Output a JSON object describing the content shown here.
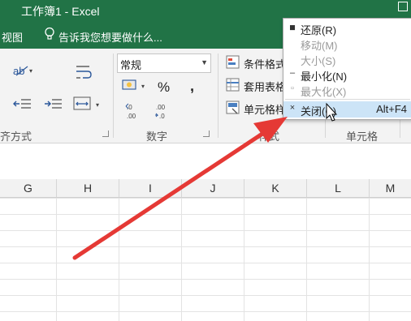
{
  "window": {
    "title": "工作簿1 - Excel"
  },
  "ribbon": {
    "view_tab": "视图",
    "tell_me": "告诉我您想要做什么...",
    "number_format": "常规",
    "percent": "%",
    "comma": ",",
    "dec_increase": "←0\n.00",
    "dec_decrease": ".00\n→.0",
    "cond_format": "条件格式",
    "table_format": "套用表格",
    "cell_styles": "单元格样",
    "groups": {
      "alignment": "齐方式",
      "number": "数字",
      "styles": "样式",
      "cells": "单元格"
    }
  },
  "columns": [
    "G",
    "H",
    "I",
    "J",
    "K",
    "L",
    "M"
  ],
  "system_menu": {
    "items": [
      {
        "label": "还原(R)",
        "glyph": "◾",
        "shortcut": "",
        "state": "enabled"
      },
      {
        "label": "移动(M)",
        "glyph": "",
        "shortcut": "",
        "state": "disabled"
      },
      {
        "label": "大小(S)",
        "glyph": "",
        "shortcut": "",
        "state": "disabled"
      },
      {
        "label": "最小化(N)",
        "glyph": "–",
        "shortcut": "",
        "state": "enabled"
      },
      {
        "label": "最大化(X)",
        "glyph": "▫",
        "shortcut": "",
        "state": "disabled"
      },
      {
        "label": "关闭(C)",
        "glyph": "×",
        "shortcut": "Alt+F4",
        "state": "highlighted"
      }
    ]
  },
  "colors": {
    "excel_green": "#217346",
    "ribbon_bg": "#f3f3f3",
    "menu_highlight": "#cce4f7",
    "arrow_red": "#e53935"
  }
}
